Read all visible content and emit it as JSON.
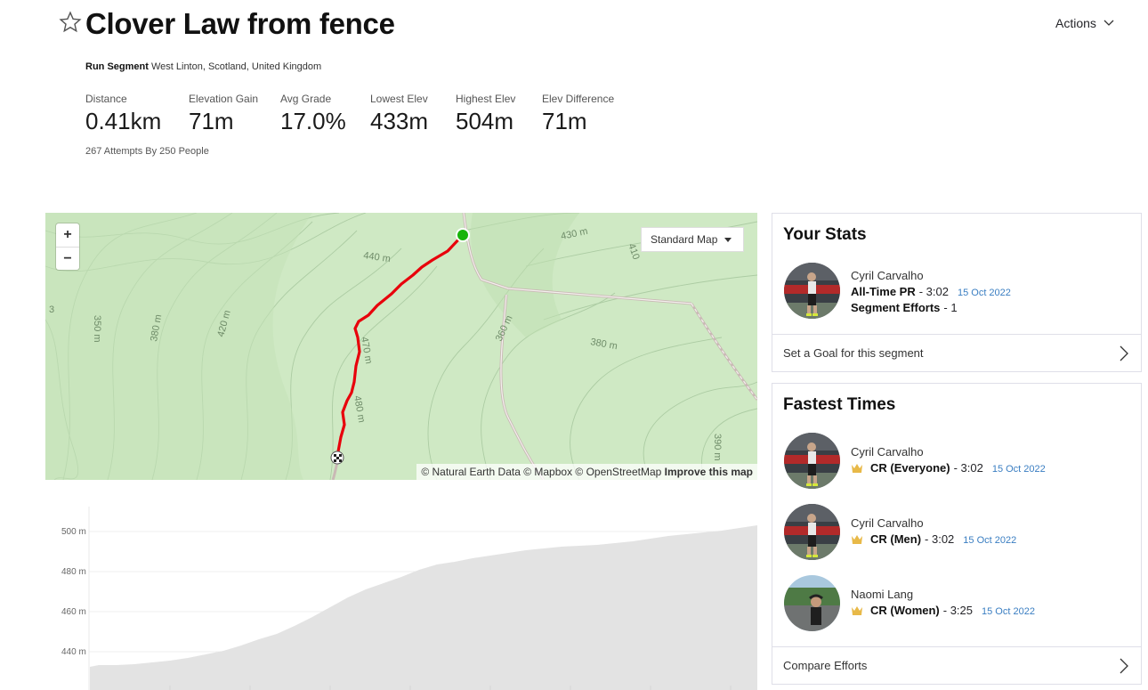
{
  "header": {
    "title": "Clover Law from fence",
    "actions_label": "Actions",
    "segment_type": "Run Segment",
    "location": "West Linton, Scotland, United Kingdom"
  },
  "stats": [
    {
      "label": "Distance",
      "value": "0.41km"
    },
    {
      "label": "Elevation Gain",
      "value": "71m"
    },
    {
      "label": "Avg Grade",
      "value": "17.0%"
    },
    {
      "label": "Lowest Elev",
      "value": "433m"
    },
    {
      "label": "Highest Elev",
      "value": "504m"
    },
    {
      "label": "Elev Difference",
      "value": "71m"
    }
  ],
  "attempts": "267 Attempts By 250 People",
  "map": {
    "zoom_in": "+",
    "zoom_out": "−",
    "type_label": "Standard Map",
    "attribution": "© Natural Earth Data © Mapbox © OpenStreetMap",
    "improve_link": "Improve this map",
    "contour_labels": [
      "430 m",
      "440 m",
      "410",
      "350 m",
      "380 m",
      "420 m",
      "470 m",
      "480 m",
      "360 m",
      "380 m",
      "390 m",
      "3"
    ],
    "route_color": "#e8000b",
    "start_color": "#19b40b"
  },
  "elevation": {
    "y_ticks": [
      "500 m",
      "480 m",
      "460 m",
      "440 m"
    ],
    "fill_color": "#e3e3e3"
  },
  "your_stats": {
    "title": "Your Stats",
    "athlete": "Cyril Carvalho",
    "pr_label": "All-Time PR",
    "pr_time": "- 3:02",
    "pr_date": "15 Oct 2022",
    "efforts_label": "Segment Efforts",
    "efforts_count": "- 1",
    "goal_link": "Set a Goal for this segment"
  },
  "fastest_times": {
    "title": "Fastest Times",
    "entries": [
      {
        "athlete": "Cyril Carvalho",
        "category": "CR (Everyone)",
        "time": "- 3:02",
        "date": "15 Oct 2022"
      },
      {
        "athlete": "Cyril Carvalho",
        "category": "CR (Men)",
        "time": "- 3:02",
        "date": "15 Oct 2022"
      },
      {
        "athlete": "Naomi Lang",
        "category": "CR (Women)",
        "time": "- 3:25",
        "date": "15 Oct 2022"
      }
    ],
    "compare_link": "Compare Efforts"
  }
}
